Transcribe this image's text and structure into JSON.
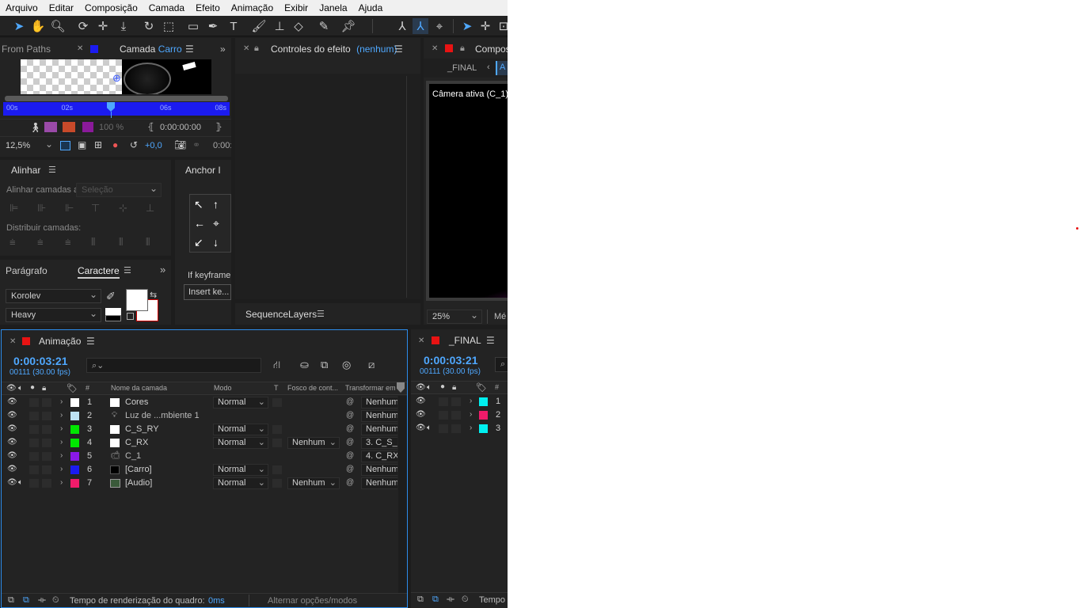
{
  "menu": [
    "Arquivo",
    "Editar",
    "Composição",
    "Camada",
    "Efeito",
    "Animação",
    "Exibir",
    "Janela",
    "Ajuda"
  ],
  "colors": {
    "accent": "#4fa8ff",
    "panel": "#232323",
    "focus_border": "#2d8ceb",
    "red": "#e81313",
    "timeline_bar": "#1b1bf0"
  },
  "layer_panel": {
    "prev_tab": "From Paths",
    "tab": "Camada",
    "tab_layer": "Carro",
    "ruler": [
      "00s",
      "02s",
      "",
      "06s",
      "08s"
    ],
    "opacity": "100 %",
    "timecode": "0:00:00:00",
    "zoom": "12,5%",
    "exposure": "+0,0",
    "time_cut": "0:00:"
  },
  "effect_panel": {
    "title": "Controles do efeito",
    "target": "(nenhum)"
  },
  "comp_panel": {
    "title": "Compos",
    "crumb": "_FINAL",
    "crumb2": "A",
    "camera": "Câmera ativa (C_1)",
    "zoom": "25%",
    "res": "Mé"
  },
  "align_panel": {
    "title": "Alinhar",
    "align_label": "Alinhar camadas a:",
    "align_to": "Seleção",
    "distribute_label": "Distribuir camadas:"
  },
  "anchor_panel": {
    "title": "Anchor I",
    "keyframe_label": "If keyframe",
    "insert_label": "Insert ke..."
  },
  "sequence_panel": {
    "title": "SequenceLayers"
  },
  "char_panel": {
    "tab_paragraph": "Parágrafo",
    "tab_character": "Caractere",
    "font": "Korolev",
    "style": "Heavy"
  },
  "timeline": {
    "title": "Animação",
    "timecode": "0:00:03:21",
    "frames": "00111 (30.00 fps)",
    "search_placeholder": "",
    "col_num": "#",
    "col_name": "Nome da camada",
    "col_mode": "Modo",
    "col_t": "T",
    "col_matte": "Fosco de cont...",
    "col_parent": "Transformar em",
    "layers": [
      {
        "num": "1",
        "name": "Cores",
        "color": "#ffffff",
        "icon": "solid-white",
        "mode": "Normal",
        "matte": "",
        "parent": "Nenhum"
      },
      {
        "num": "2",
        "name": "Luz de ...mbiente 1",
        "color": "#bde2f3",
        "icon": "light",
        "mode": "",
        "matte": "",
        "parent": "Nenhum"
      },
      {
        "num": "3",
        "name": "C_S_RY",
        "color": "#00e600",
        "icon": "solid-white",
        "mode": "Normal",
        "matte": "",
        "parent": "Nenhum"
      },
      {
        "num": "4",
        "name": "C_RX",
        "color": "#00e600",
        "icon": "solid-white",
        "mode": "Normal",
        "matte": "Nenhum",
        "parent": "3. C_S_"
      },
      {
        "num": "5",
        "name": "C_1",
        "color": "#8a18e8",
        "icon": "camera",
        "mode": "",
        "matte": "",
        "parent": "4. C_RX"
      },
      {
        "num": "6",
        "name": "[Carro]",
        "color": "#1b1bf0",
        "icon": "solid-black",
        "mode": "Normal",
        "matte": "",
        "parent": "Nenhum"
      },
      {
        "num": "7",
        "name": "[Audio]",
        "color": "#f01b6a",
        "icon": "comp",
        "mode": "Normal",
        "matte": "Nenhum",
        "parent": "Nenhum"
      }
    ],
    "render_label": "Tempo de renderização do quadro:",
    "render_value": "0ms",
    "toggle_label": "Alternar opções/modos"
  },
  "final_timeline": {
    "title": "_FINAL",
    "timecode": "0:00:03:21",
    "frames": "00111 (30.00 fps)",
    "col_num": "#",
    "layers": [
      {
        "num": "1",
        "color": "#00f0f0",
        "audio": false
      },
      {
        "num": "2",
        "color": "#f01b6a",
        "audio": false
      },
      {
        "num": "3",
        "color": "#00f0f0",
        "audio": true
      }
    ],
    "render_label": "Tempo"
  }
}
